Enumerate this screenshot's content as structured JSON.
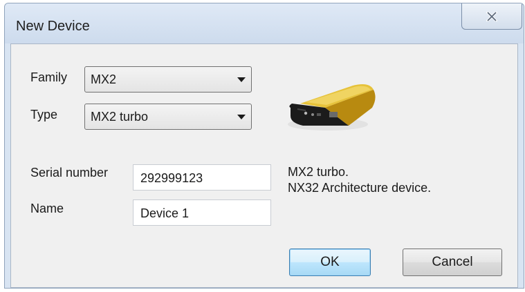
{
  "window": {
    "title": "New Device",
    "close_icon": "close-icon"
  },
  "form": {
    "family": {
      "label": "Family",
      "value": "MX2"
    },
    "type": {
      "label": "Type",
      "value": "MX2 turbo"
    },
    "serial_number": {
      "label": "Serial number",
      "value": "292999123"
    },
    "name": {
      "label": "Name",
      "value": "Device 1"
    }
  },
  "description": {
    "line1": "MX2 turbo.",
    "line2": "NX32 Architecture device."
  },
  "buttons": {
    "ok_label": "OK",
    "cancel_label": "Cancel"
  },
  "device_image": "device-enclosure-image",
  "colors": {
    "device_body": "#d4a017",
    "device_face": "#1b1b1b"
  }
}
